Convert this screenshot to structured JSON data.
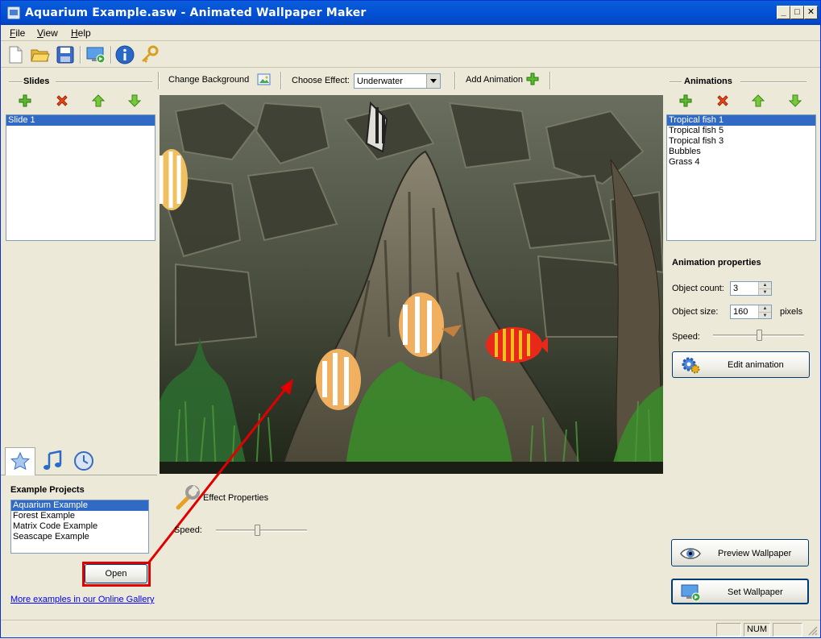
{
  "window": {
    "title": "Aquarium Example.asw - Animated Wallpaper Maker"
  },
  "menu": {
    "file": "File",
    "view": "View",
    "help": "Help"
  },
  "toolbar_icons": [
    "new-file-icon",
    "open-folder-icon",
    "save-icon",
    "preview-monitor-icon",
    "info-icon",
    "key-icon"
  ],
  "slides": {
    "header": "Slides",
    "items": [
      {
        "label": "Slide 1",
        "selected": true
      }
    ]
  },
  "editor": {
    "change_background": "Change Background",
    "choose_effect_label": "Choose Effect:",
    "effect_value": "Underwater",
    "add_animation": "Add Animation"
  },
  "animations": {
    "header": "Animations",
    "items": [
      {
        "label": "Tropical fish 1",
        "selected": true
      },
      {
        "label": "Tropical fish 5",
        "selected": false
      },
      {
        "label": "Tropical fish 3",
        "selected": false
      },
      {
        "label": "Bubbles",
        "selected": false
      },
      {
        "label": "Grass 4",
        "selected": false
      }
    ]
  },
  "animation_properties": {
    "header": "Animation properties",
    "object_count_label": "Object count:",
    "object_count": "3",
    "object_size_label": "Object size:",
    "object_size": "160",
    "object_size_unit": "pixels",
    "speed_label": "Speed:",
    "speed_level": 0.5,
    "edit_button": "Edit animation"
  },
  "effect_properties": {
    "title": "Effect Properties",
    "speed_label": "Speed:",
    "speed_level": 0.45
  },
  "examples": {
    "header": "Example Projects",
    "items": [
      {
        "label": "Aquarium Example",
        "selected": true
      },
      {
        "label": "Forest Example",
        "selected": false
      },
      {
        "label": "Matrix Code Example",
        "selected": false
      },
      {
        "label": "Seascape Example",
        "selected": false
      }
    ],
    "open_button": "Open",
    "gallery_link": "More examples in our Online Gallery"
  },
  "actions": {
    "preview": "Preview Wallpaper",
    "set": "Set Wallpaper"
  },
  "status": {
    "num": "NUM"
  },
  "colors": {
    "selection": "#316ac5",
    "titlebar": "#0553d6",
    "annotation": "#e00000"
  }
}
